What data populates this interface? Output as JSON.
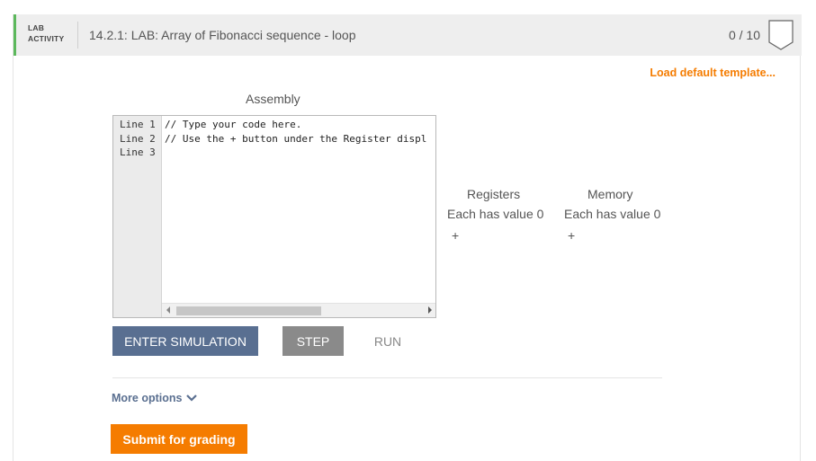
{
  "header": {
    "tag_line1": "LAB",
    "tag_line2": "ACTIVITY",
    "title": "14.2.1: LAB: Array of Fibonacci sequence - loop",
    "score": "0 / 10",
    "accent_color": "#5cb85c"
  },
  "toolbar": {
    "load_template_label": "Load default template..."
  },
  "editor": {
    "title": "Assembly",
    "line_numbers": [
      "Line 1",
      "Line 2",
      "Line 3"
    ],
    "code_lines": [
      "// Type your code here.",
      "// Use the + button under the Register displ",
      ""
    ]
  },
  "registers": {
    "title": "Registers",
    "subtitle": "Each has value 0",
    "add_label": "+"
  },
  "memory": {
    "title": "Memory",
    "subtitle": "Each has value 0",
    "add_label": "+"
  },
  "controls": {
    "enter_simulation": "ENTER SIMULATION",
    "step": "STEP",
    "run": "RUN"
  },
  "footer": {
    "more_options": "More options",
    "submit": "Submit for grading",
    "brand_color": "#f57c00"
  }
}
